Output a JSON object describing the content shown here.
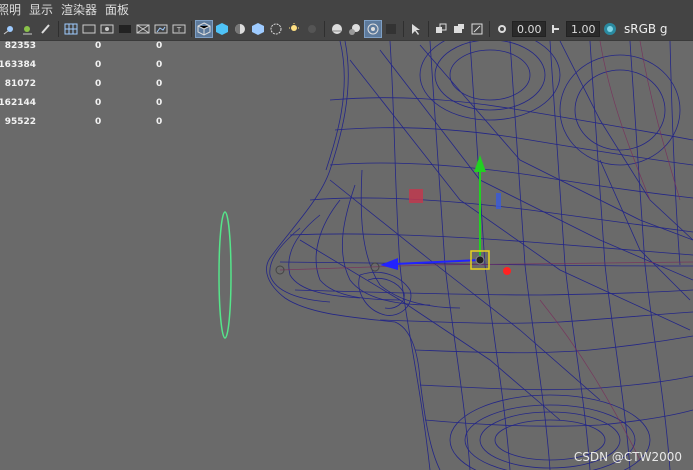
{
  "menu": [
    "照明",
    "显示",
    "渲染器",
    "面板"
  ],
  "toolbar": {
    "icons": [
      "lights-icon",
      "shadow-icon",
      "pen-icon",
      "grid-icon",
      "film-gate-icon",
      "resolution-gate-icon",
      "gate-mask-icon",
      "field-chart-icon",
      "safe-action-icon",
      "safe-title-icon",
      "wireframe-icon",
      "smooth-shade-icon",
      "shade-all-icon",
      "textured-icon",
      "use-lights-icon",
      "shadows-icon",
      "occlusion-icon",
      "motion-blur-icon",
      "ambient-icon",
      "xray-icon",
      "xray-joints-icon",
      "xray-active-icon",
      "select-tool-icon",
      "isolate-icon",
      "camera-icon",
      "view-icon",
      "exposure-icon",
      "gamma-icon",
      "color-space-icon"
    ],
    "exposure_value": "0.00",
    "gamma_value": "1.00",
    "color_space_label": "sRGB g"
  },
  "hud": {
    "rows": [
      {
        "c0": "82353",
        "c1": "0",
        "c2": "0"
      },
      {
        "c0": "163384",
        "c1": "0",
        "c2": "0"
      },
      {
        "c0": "81072",
        "c1": "0",
        "c2": "0"
      },
      {
        "c0": "162144",
        "c1": "0",
        "c2": "0"
      },
      {
        "c0": "95522",
        "c1": "0",
        "c2": "0"
      }
    ]
  },
  "colors": {
    "mesh": "#1c1f8a",
    "ring": "#55e58a",
    "arrow_y": "#22d022",
    "arrow_x": "#2222ff",
    "handle_red": "#ff2222",
    "selected_box": "#e8d21c"
  },
  "watermark": "CSDN @CTW2000"
}
